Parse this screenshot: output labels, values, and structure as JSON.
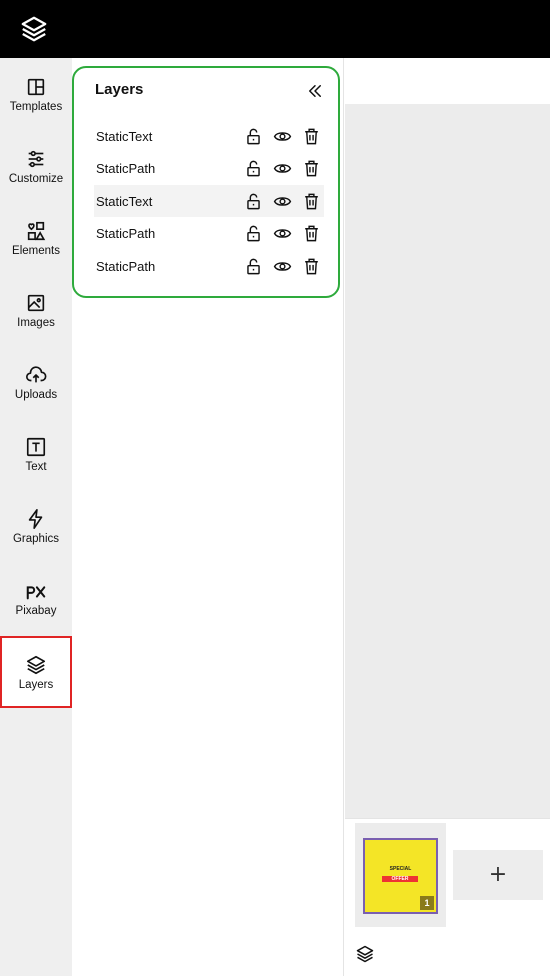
{
  "app": {
    "logo_icon": "stack-layers-icon"
  },
  "rail": {
    "items": [
      {
        "key": "templates",
        "label": "Templates",
        "icon": "template-grid-icon"
      },
      {
        "key": "customize",
        "label": "Customize",
        "icon": "sliders-icon"
      },
      {
        "key": "elements",
        "label": "Elements",
        "icon": "shapes-icon"
      },
      {
        "key": "images",
        "label": "Images",
        "icon": "image-icon"
      },
      {
        "key": "uploads",
        "label": "Uploads",
        "icon": "cloud-upload-icon"
      },
      {
        "key": "text",
        "label": "Text",
        "icon": "text-box-icon"
      },
      {
        "key": "graphics",
        "label": "Graphics",
        "icon": "lightning-icon"
      },
      {
        "key": "pixabay",
        "label": "Pixabay",
        "icon": "pixabay-icon"
      },
      {
        "key": "layers",
        "label": "Layers",
        "icon": "layers-icon",
        "active": true
      }
    ]
  },
  "layers_panel": {
    "title": "Layers",
    "collapse_icon": "double-chevron-left-icon",
    "rows": [
      {
        "name": "StaticText"
      },
      {
        "name": "StaticPath"
      },
      {
        "name": "StaticText",
        "highlighted": true
      },
      {
        "name": "StaticPath"
      },
      {
        "name": "StaticPath"
      }
    ]
  },
  "pages": {
    "thumb": {
      "line1": "SPECIAL",
      "line2": "OFFER",
      "page_number": "1"
    },
    "add_label": "+"
  },
  "colors": {
    "accent_green": "#2eaa3c",
    "active_red": "#e02424",
    "thumb_yellow": "#f4e526"
  }
}
